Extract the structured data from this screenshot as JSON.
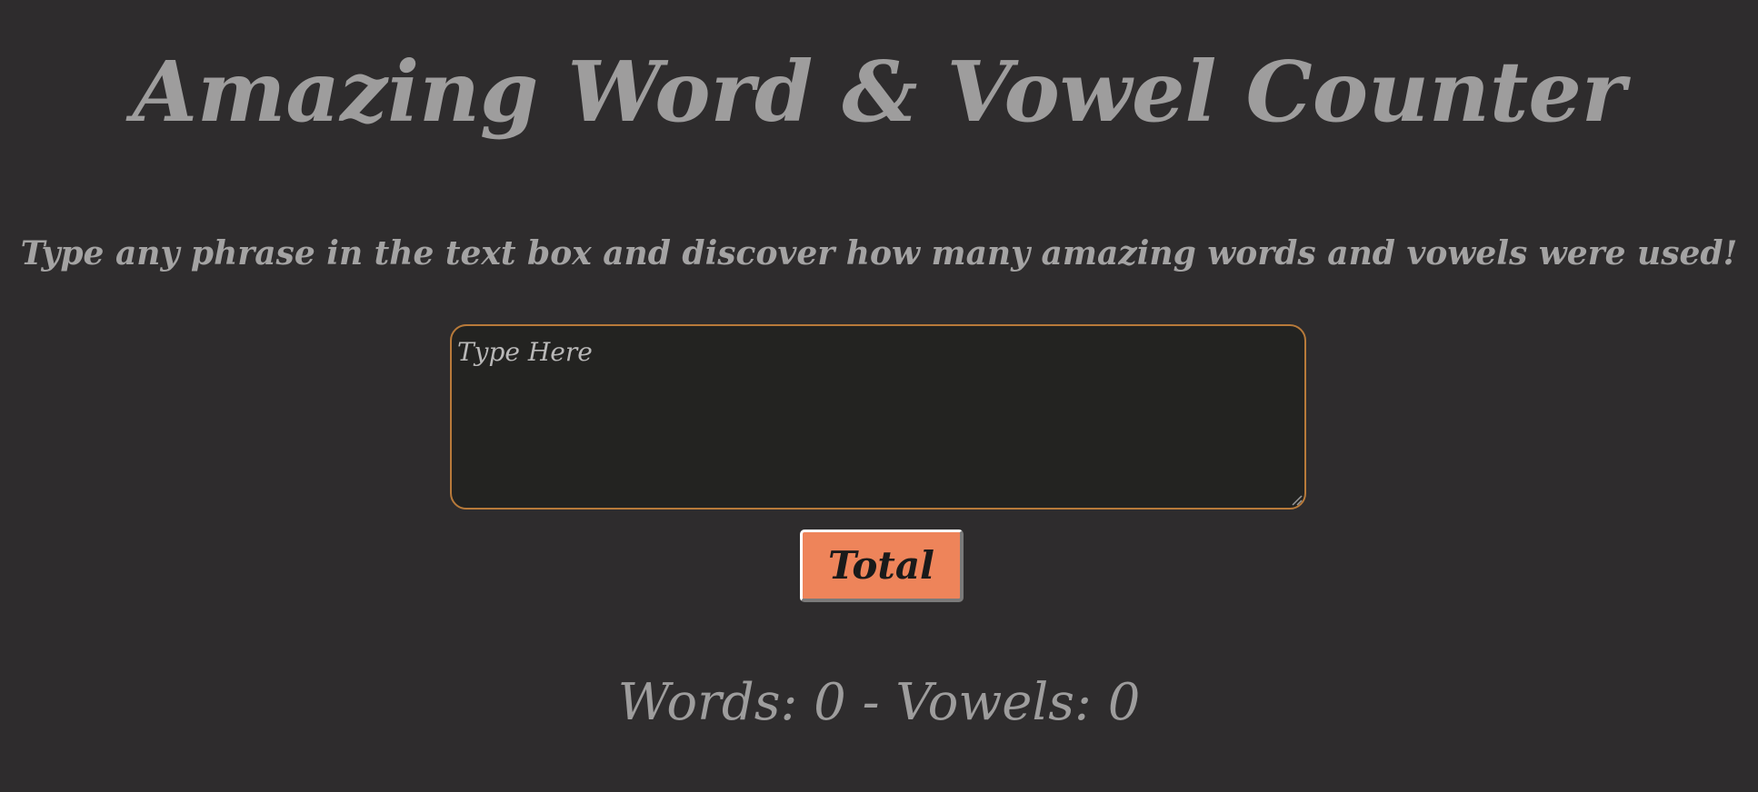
{
  "page": {
    "title": "Amazing Word & Vowel Counter",
    "subtitle": "Type any phrase in the text box and discover how many amazing words and vowels were used!"
  },
  "input": {
    "value": "",
    "placeholder": "Type Here"
  },
  "button": {
    "label": "Total"
  },
  "results": {
    "text": "Words: 0 - Vowels: 0"
  },
  "colors": {
    "background": "#2e2c2d",
    "text": "#9e9d9d",
    "input_background": "#232321",
    "input_border": "#b87a3a",
    "button_background": "#ee845a"
  }
}
